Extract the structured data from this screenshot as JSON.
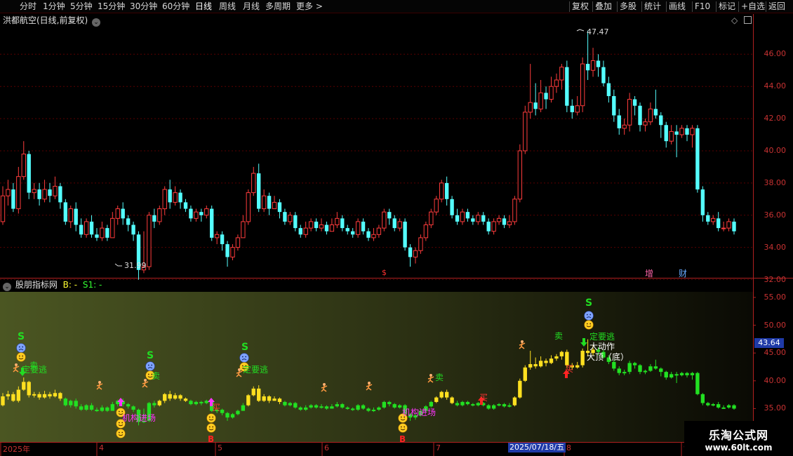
{
  "toolbar": {
    "periods": [
      "分时",
      "1分钟",
      "5分钟",
      "15分钟",
      "30分钟",
      "60分钟",
      "日线",
      "周线",
      "月线",
      "多周期",
      "更多 >"
    ],
    "active_period": "日线",
    "right_buttons": [
      "复权",
      "叠加",
      "多股",
      "统计",
      "画线",
      "F10",
      "标记",
      "+自选",
      "返回"
    ]
  },
  "main_chart": {
    "title": "洪都航空(日线,前复权)",
    "y_ticks": [
      "46.00",
      "44.00",
      "42.00",
      "40.00",
      "38.00",
      "36.00",
      "34.00",
      "32.00"
    ],
    "high_label": "47.47",
    "low_label": "31.99",
    "bottom_markers": [
      "$",
      "增",
      "财"
    ]
  },
  "sub_chart": {
    "title": "股朋指标网",
    "b_label": "B: -",
    "s1_label": "S1: -",
    "y_ticks": [
      "55.00",
      "50.00",
      "45.00",
      "40.00",
      "35.00"
    ],
    "price_tag": "43.64",
    "signals": {
      "s1": "S",
      "s2": "S",
      "s3": "S",
      "s4": "S",
      "b1": "B",
      "b2": "B",
      "escape1": "定要逃",
      "escape2": "定要逃",
      "escape3": "定要逃",
      "inst1": "机构进场",
      "inst2": "机构进场",
      "sell1": "卖",
      "sell2": "卖",
      "sell3": "卖",
      "sell4": "卖",
      "buy1": "买",
      "buy2": "买",
      "buy3": "买",
      "big_move": "大动作",
      "top_bottom": "大顶（底）"
    }
  },
  "date_axis": {
    "labels": [
      "2025年",
      "4",
      "5",
      "6",
      "7",
      "8",
      "9"
    ],
    "cursor_date": "2025/07/18/五"
  },
  "watermark": {
    "title": "乐淘公式网",
    "url": "www.60lt.com"
  },
  "colors": {
    "up": "#ff3c3c",
    "down": "#54ffff",
    "axis": "#c83232",
    "signal_green": "#22dd22",
    "signal_magenta": "#ff33ff"
  },
  "chart_data": {
    "type": "candlestick",
    "symbol": "洪都航空",
    "period": "daily",
    "ylim": [
      31.5,
      47.8
    ],
    "candles": [
      [
        35.6,
        37.2,
        37.8,
        35.4
      ],
      [
        37.2,
        37.6,
        38.2,
        36.6
      ],
      [
        37.6,
        36.4,
        38.0,
        36.2
      ],
      [
        36.4,
        38.4,
        39.0,
        36.1
      ],
      [
        38.4,
        39.8,
        40.6,
        38.2
      ],
      [
        39.8,
        37.4,
        40.0,
        37.0
      ],
      [
        37.4,
        37.6,
        38.0,
        37.0
      ],
      [
        37.6,
        37.0,
        38.0,
        36.6
      ],
      [
        37.0,
        37.6,
        38.2,
        36.8
      ],
      [
        37.6,
        37.2,
        38.0,
        36.8
      ],
      [
        37.2,
        37.8,
        38.4,
        37.0
      ],
      [
        37.8,
        36.8,
        38.0,
        36.4
      ],
      [
        36.8,
        35.6,
        37.0,
        35.4
      ],
      [
        35.6,
        36.4,
        36.6,
        35.2
      ],
      [
        36.4,
        35.4,
        36.8,
        35.0
      ],
      [
        35.4,
        34.8,
        35.8,
        34.6
      ],
      [
        34.8,
        35.6,
        35.8,
        34.6
      ],
      [
        35.6,
        34.8,
        36.0,
        34.6
      ],
      [
        34.8,
        34.6,
        35.2,
        34.4
      ],
      [
        34.6,
        35.2,
        35.6,
        34.4
      ],
      [
        35.2,
        34.6,
        35.4,
        34.4
      ],
      [
        34.6,
        35.8,
        36.2,
        34.6
      ],
      [
        35.8,
        36.4,
        36.6,
        35.4
      ],
      [
        36.4,
        35.8,
        36.8,
        35.4
      ],
      [
        35.8,
        35.4,
        36.0,
        35.0
      ],
      [
        35.4,
        34.8,
        35.6,
        34.4
      ],
      [
        34.8,
        32.6,
        35.0,
        31.99
      ],
      [
        32.6,
        32.8,
        35.0,
        32.4
      ],
      [
        32.8,
        36.0,
        36.2,
        32.6
      ],
      [
        36.0,
        35.6,
        36.4,
        35.2
      ],
      [
        35.6,
        36.4,
        36.6,
        35.4
      ],
      [
        36.4,
        37.6,
        37.8,
        36.0
      ],
      [
        37.6,
        36.8,
        38.2,
        36.4
      ],
      [
        36.8,
        37.4,
        37.8,
        36.6
      ],
      [
        37.4,
        36.8,
        37.6,
        36.4
      ],
      [
        36.8,
        36.4,
        37.0,
        36.2
      ],
      [
        36.4,
        35.8,
        36.6,
        35.6
      ],
      [
        35.8,
        36.2,
        36.4,
        35.6
      ],
      [
        36.2,
        36.0,
        36.4,
        35.6
      ],
      [
        36.0,
        36.4,
        36.6,
        35.8
      ],
      [
        36.4,
        34.6,
        36.6,
        34.4
      ],
      [
        34.6,
        34.8,
        35.0,
        34.2
      ],
      [
        34.8,
        34.2,
        35.0,
        33.8
      ],
      [
        34.2,
        33.4,
        34.4,
        32.8
      ],
      [
        33.4,
        34.0,
        34.2,
        33.2
      ],
      [
        34.0,
        34.6,
        34.8,
        33.8
      ],
      [
        34.6,
        35.6,
        36.0,
        34.6
      ],
      [
        35.6,
        37.4,
        37.6,
        35.4
      ],
      [
        37.4,
        38.6,
        39.0,
        37.2
      ],
      [
        38.6,
        36.4,
        39.2,
        36.2
      ],
      [
        36.4,
        37.2,
        37.6,
        36.2
      ],
      [
        37.2,
        36.4,
        37.4,
        36.0
      ],
      [
        36.4,
        36.8,
        37.2,
        36.4
      ],
      [
        36.8,
        36.2,
        37.0,
        35.8
      ],
      [
        36.2,
        35.6,
        36.4,
        35.4
      ],
      [
        35.6,
        36.0,
        36.2,
        35.4
      ],
      [
        36.0,
        35.2,
        36.2,
        35.0
      ],
      [
        35.2,
        34.8,
        35.4,
        34.6
      ],
      [
        34.8,
        35.2,
        35.6,
        34.6
      ],
      [
        35.2,
        35.6,
        35.8,
        35.0
      ],
      [
        35.6,
        35.2,
        35.8,
        35.0
      ],
      [
        35.2,
        35.4,
        35.8,
        35.0
      ],
      [
        35.4,
        35.0,
        35.6,
        34.8
      ],
      [
        35.0,
        35.4,
        35.8,
        35.0
      ],
      [
        35.4,
        35.8,
        36.2,
        35.2
      ],
      [
        35.8,
        35.2,
        36.0,
        35.0
      ],
      [
        35.2,
        35.0,
        35.4,
        34.8
      ],
      [
        35.0,
        34.8,
        35.2,
        34.6
      ],
      [
        34.8,
        35.6,
        35.8,
        34.6
      ],
      [
        35.6,
        35.0,
        35.8,
        34.8
      ],
      [
        35.0,
        34.6,
        35.2,
        34.4
      ],
      [
        34.6,
        34.8,
        35.2,
        34.4
      ],
      [
        34.8,
        35.2,
        35.4,
        34.6
      ],
      [
        35.2,
        36.2,
        36.4,
        35.0
      ],
      [
        36.2,
        35.8,
        36.4,
        35.4
      ],
      [
        35.8,
        35.2,
        36.0,
        35.0
      ],
      [
        35.2,
        35.6,
        35.8,
        35.0
      ],
      [
        35.6,
        34.0,
        35.8,
        33.8
      ],
      [
        34.0,
        33.4,
        34.2,
        32.8
      ],
      [
        33.4,
        33.8,
        34.0,
        33.0
      ],
      [
        33.8,
        34.6,
        34.8,
        33.6
      ],
      [
        34.6,
        35.4,
        35.6,
        34.4
      ],
      [
        35.4,
        36.2,
        36.4,
        35.2
      ],
      [
        36.2,
        37.0,
        37.2,
        36.0
      ],
      [
        37.0,
        38.0,
        38.2,
        36.8
      ],
      [
        38.0,
        37.0,
        38.4,
        36.6
      ],
      [
        37.0,
        36.0,
        37.2,
        35.8
      ],
      [
        36.0,
        35.6,
        36.4,
        35.4
      ],
      [
        35.6,
        36.2,
        36.4,
        35.4
      ],
      [
        36.2,
        35.8,
        36.4,
        35.6
      ],
      [
        35.8,
        35.6,
        36.0,
        35.4
      ],
      [
        35.6,
        36.0,
        36.2,
        35.4
      ],
      [
        36.0,
        35.6,
        36.2,
        35.4
      ],
      [
        35.6,
        35.0,
        35.8,
        34.8
      ],
      [
        35.0,
        35.6,
        35.8,
        34.8
      ],
      [
        35.6,
        35.8,
        36.0,
        35.4
      ],
      [
        35.8,
        35.4,
        36.0,
        35.2
      ],
      [
        35.4,
        35.6,
        36.0,
        35.2
      ],
      [
        35.6,
        37.0,
        37.2,
        35.4
      ],
      [
        37.0,
        40.0,
        40.4,
        36.8
      ],
      [
        40.0,
        42.4,
        42.8,
        39.8
      ],
      [
        42.4,
        43.0,
        45.4,
        42.0
      ],
      [
        43.0,
        42.6,
        44.2,
        42.2
      ],
      [
        42.6,
        43.6,
        44.4,
        42.4
      ],
      [
        43.6,
        43.2,
        44.0,
        42.6
      ],
      [
        43.2,
        44.0,
        44.6,
        43.0
      ],
      [
        44.0,
        44.4,
        44.8,
        43.6
      ],
      [
        44.4,
        45.2,
        45.4,
        43.8
      ],
      [
        45.2,
        42.8,
        45.6,
        42.4
      ],
      [
        42.8,
        42.4,
        43.2,
        42.0
      ],
      [
        42.4,
        42.8,
        43.4,
        42.2
      ],
      [
        42.8,
        45.4,
        45.8,
        42.4
      ],
      [
        45.4,
        45.0,
        47.47,
        44.4
      ],
      [
        45.0,
        45.6,
        46.4,
        44.6
      ],
      [
        45.6,
        45.2,
        46.0,
        44.6
      ],
      [
        45.2,
        44.2,
        45.6,
        44.0
      ],
      [
        44.2,
        43.4,
        44.6,
        43.0
      ],
      [
        43.4,
        42.2,
        43.8,
        41.8
      ],
      [
        42.2,
        41.4,
        42.6,
        41.0
      ],
      [
        41.4,
        41.6,
        42.0,
        41.0
      ],
      [
        41.6,
        43.2,
        43.6,
        41.2
      ],
      [
        43.2,
        42.8,
        43.4,
        42.2
      ],
      [
        42.8,
        41.6,
        43.0,
        41.2
      ],
      [
        41.6,
        41.8,
        42.0,
        41.2
      ],
      [
        41.8,
        42.6,
        43.0,
        41.6
      ],
      [
        42.6,
        42.2,
        43.8,
        42.0
      ],
      [
        42.2,
        41.6,
        42.4,
        40.8
      ],
      [
        41.6,
        40.6,
        41.8,
        40.2
      ],
      [
        40.6,
        41.2,
        41.6,
        40.4
      ],
      [
        41.2,
        41.0,
        41.6,
        39.6
      ],
      [
        41.0,
        41.4,
        41.6,
        40.8
      ],
      [
        41.4,
        41.0,
        41.6,
        40.6
      ],
      [
        41.0,
        41.4,
        41.6,
        40.2
      ],
      [
        41.4,
        37.6,
        41.6,
        37.4
      ],
      [
        37.6,
        36.0,
        37.8,
        35.6
      ],
      [
        36.0,
        35.6,
        36.2,
        35.4
      ],
      [
        35.6,
        35.8,
        36.0,
        35.4
      ],
      [
        35.8,
        35.2,
        36.2,
        35.0
      ],
      [
        35.2,
        35.2,
        35.6,
        35.0
      ],
      [
        35.2,
        35.6,
        35.8,
        35.0
      ],
      [
        35.6,
        35.0,
        35.8,
        34.8
      ]
    ],
    "sub_chart": {
      "ylim": [
        29.0,
        56.0
      ],
      "y_ticks": [
        55,
        50,
        45,
        40,
        35
      ]
    }
  }
}
